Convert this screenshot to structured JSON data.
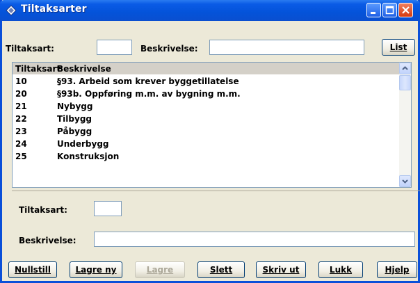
{
  "window": {
    "title": "Tiltaksarter"
  },
  "filter": {
    "tiltaksart_label": "Tiltaksart:",
    "tiltaksart_value": "",
    "beskrivelse_label": "Beskrivelse:",
    "beskrivelse_value": "",
    "list_button": "List"
  },
  "list": {
    "columns": [
      "Tiltaksart",
      "Beskrivelse"
    ],
    "rows": [
      {
        "code": "10",
        "desc": "§93. Arbeid som krever byggetillatelse"
      },
      {
        "code": "20",
        "desc": "§93b. Oppføring m.m. av bygning m.m."
      },
      {
        "code": "21",
        "desc": "Nybygg"
      },
      {
        "code": "22",
        "desc": "Tilbygg"
      },
      {
        "code": "23",
        "desc": "Påbygg"
      },
      {
        "code": "24",
        "desc": "Underbygg"
      },
      {
        "code": "25",
        "desc": "Konstruksjon"
      }
    ]
  },
  "detail": {
    "tiltaksart_label": "Tiltaksart:",
    "tiltaksart_value": "",
    "beskrivelse_label": "Beskrivelse:",
    "beskrivelse_value": ""
  },
  "buttons": {
    "nullstill": "Nullstill",
    "lagre_ny": "Lagre ny",
    "lagre": "Lagre",
    "slett": "Slett",
    "skriv_ut": "Skriv ut",
    "lukk": "Lukk",
    "hjelp": "Hjelp"
  }
}
